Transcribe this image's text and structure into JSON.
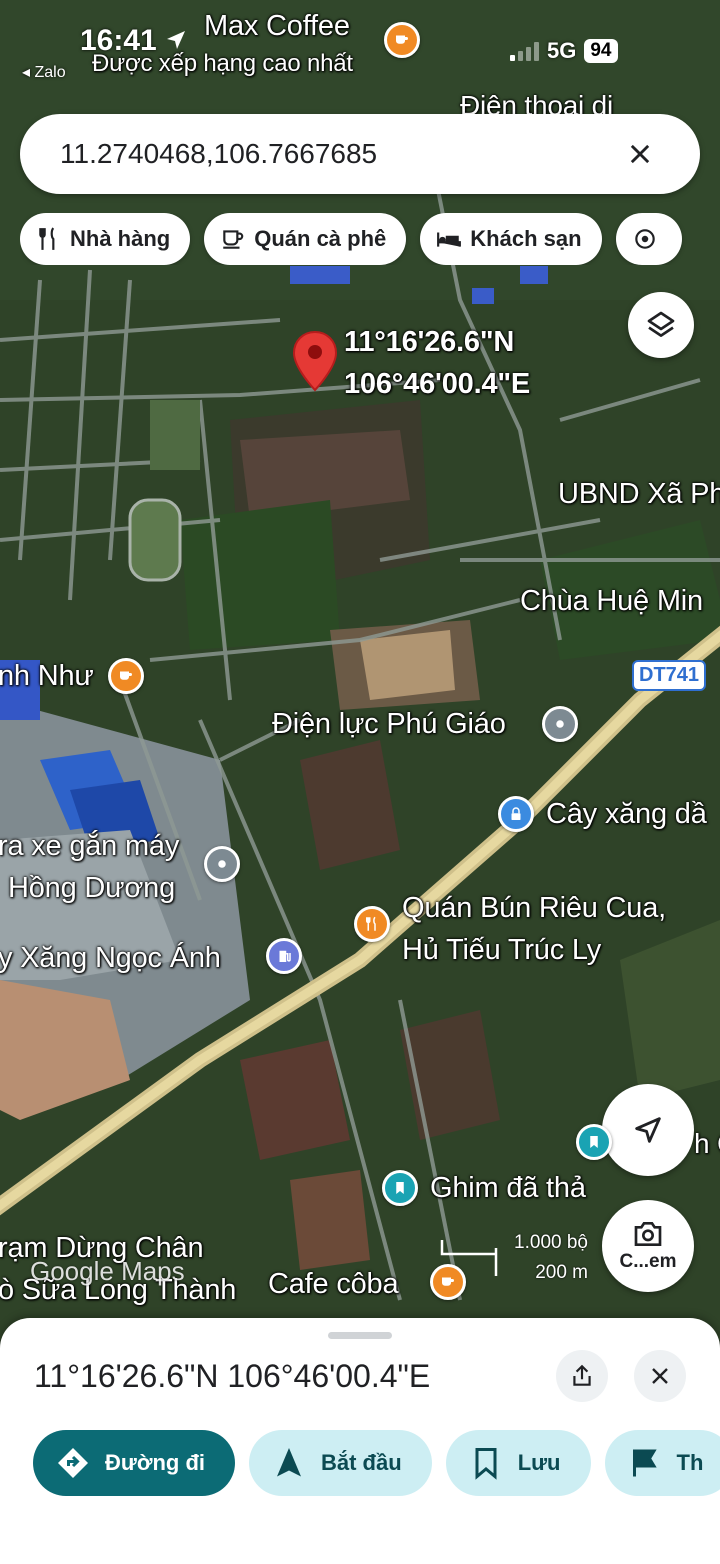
{
  "status_bar": {
    "time": "16:41",
    "back_app": "◂ Zalo",
    "network": "5G",
    "battery": "94"
  },
  "search": {
    "query": "11.2740468,106.7667685"
  },
  "chips": [
    {
      "label": "Nhà hàng",
      "icon": "restaurant-icon"
    },
    {
      "label": "Quán cà phê",
      "icon": "coffee-icon"
    },
    {
      "label": "Khách sạn",
      "icon": "hotel-icon"
    },
    {
      "label": "",
      "icon": "attraction-icon"
    }
  ],
  "map": {
    "pin_label_lat": "11°16'26.6\"N",
    "pin_label_lng": "106°46'00.4\"E",
    "places": {
      "max_coffee": "Max Coffee",
      "max_coffee_sub": "Được xếp hạng cao nhất",
      "dien_thoai": "Điện thoại di",
      "ubnd": "UBND Xã Ph",
      "chua": "Chùa Huệ Min",
      "anh_nhu": "nh Như",
      "road": "DT741",
      "dien_luc": "Điện lực Phú Giáo",
      "cay_xang": "Cây xăng dầ",
      "xe_gan_may": "ra xe gắn máy",
      "hong_duong": "Hồng Dương",
      "bun_rieu_1": "Quán Bún Riêu Cua,",
      "bun_rieu_2": "Hủ Tiếu Trúc Ly",
      "xang_ngoc_anh": "y Xăng Ngọc Ánh",
      "ghim": "Ghim đã thả",
      "tram_1": "rạm Dừng Chân",
      "tram_2": "ò Sữa Long Thành",
      "cafe_coba": "Cafe côba",
      "edge_h": "h C"
    },
    "google_logo": "Google Maps",
    "scale_ft": "1.000 bộ",
    "scale_m": "200 m",
    "camera_label": "C...em"
  },
  "sheet": {
    "coords": "11°16'26.6\"N 106°46'00.4\"E",
    "actions": [
      {
        "label": "Đường đi",
        "icon": "directions-icon"
      },
      {
        "label": "Bắt đầu",
        "icon": "navigation-icon"
      },
      {
        "label": "Lưu",
        "icon": "bookmark-icon"
      },
      {
        "label": "Th",
        "icon": "flag-icon"
      }
    ]
  }
}
